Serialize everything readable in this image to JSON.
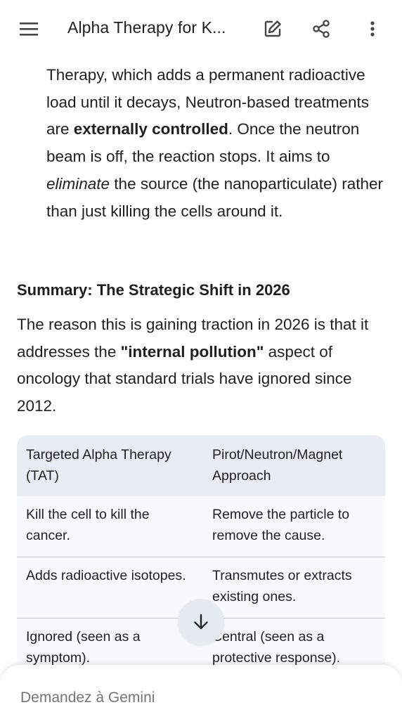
{
  "header": {
    "title": "Alpha Therapy for K...",
    "icons": [
      "menu-icon",
      "edit-icon",
      "share-icon",
      "more-vert-icon"
    ]
  },
  "intro_paragraph": {
    "part1": "Therapy, which adds a permanent radioactive load until it decays, Neutron-based treatments are ",
    "bold": "externally controlled",
    "part2": ". Once the neutron beam is off, the reaction stops. It aims to ",
    "italic": "eliminate",
    "part3": " the source (the nanoparticulate) rather than just killing the cells around it."
  },
  "summary": {
    "heading": "Summary: The Strategic Shift in 2026",
    "part1": "The reason this is gaining traction in 2026 is that it addresses the ",
    "bold": "\"internal pollution\"",
    "part2": " aspect of oncology that standard trials have ignored since 2012."
  },
  "table": {
    "headers": [
      "Targeted Alpha Therapy (TAT)",
      "Pirot/Neutron/Magnet Approach"
    ],
    "rows": [
      [
        "Kill the cell to kill the cancer.",
        "Remove the particle to remove the cause."
      ],
      [
        "Adds radioactive isotopes.",
        "Transmutes or extracts existing ones."
      ],
      [
        "Ignored (seen as a symptom).",
        "Central (seen as a protective response)."
      ]
    ]
  },
  "composer": {
    "placeholder": "Demandez à Gemini"
  },
  "colors": {
    "table_header_bg": "#e8edf5",
    "table_row_bg": "#f7f9fc",
    "scroll_button_bg": "#e6ebf1",
    "text": "#1f1f1f"
  }
}
